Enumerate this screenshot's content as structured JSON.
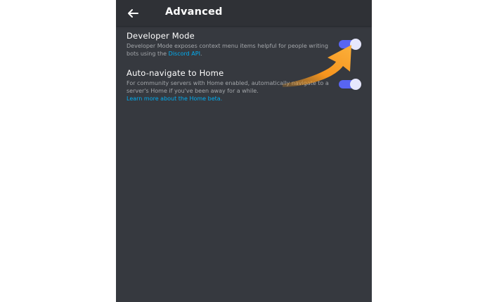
{
  "header": {
    "title": "Advanced",
    "back_icon": "arrow-left-icon"
  },
  "settings": [
    {
      "title": "Developer Mode",
      "desc_before_link": "Developer Mode exposes context menu items helpful for people writing bots using the ",
      "link_text": "Discord API",
      "desc_after_link": ".",
      "enabled": true
    },
    {
      "title": "Auto-navigate to Home",
      "desc": "For community servers with Home enabled, automatically navigate to a server's Home if you've been away for a while.",
      "link_text": "Learn more about the Home beta.",
      "enabled": true
    }
  ],
  "colors": {
    "background": "#36393f",
    "header": "#2f3136",
    "toggle_on": "#5865f2",
    "link": "#00aff4",
    "annotation_arrow": "#f7941d"
  },
  "annotation": {
    "icon": "orange-pointer-arrow-icon"
  }
}
